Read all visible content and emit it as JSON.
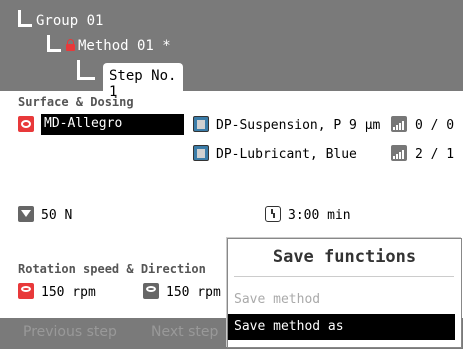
{
  "header": {
    "group": "Group 01",
    "method": "Method 01 *",
    "step_tab": "Step No. 1"
  },
  "surface": {
    "section_label": "Surface & Dosing",
    "surface_name": "MD-Allegro",
    "suspension": "DP-Suspension, P 9 µm",
    "suspension_level": "0 / 0",
    "lubricant": "DP-Lubricant, Blue",
    "lubricant_level": "2 / 1"
  },
  "force": "50 N",
  "time": "3:00 min",
  "rotation": {
    "section_label": "Rotation speed & Direction",
    "speed1": "150 rpm",
    "speed2": "150 rpm"
  },
  "bottom": {
    "prev": "Previous step",
    "next": "Next step"
  },
  "popup": {
    "title": "Save functions",
    "save_method": "Save method",
    "save_method_as": "Save method as"
  },
  "icons": {
    "surface": "disc-icon",
    "dosing": "bottle-icon",
    "level": "level-bars-icon",
    "force": "force-down-icon",
    "time": "clock-icon",
    "rotation": "rotation-icon"
  }
}
